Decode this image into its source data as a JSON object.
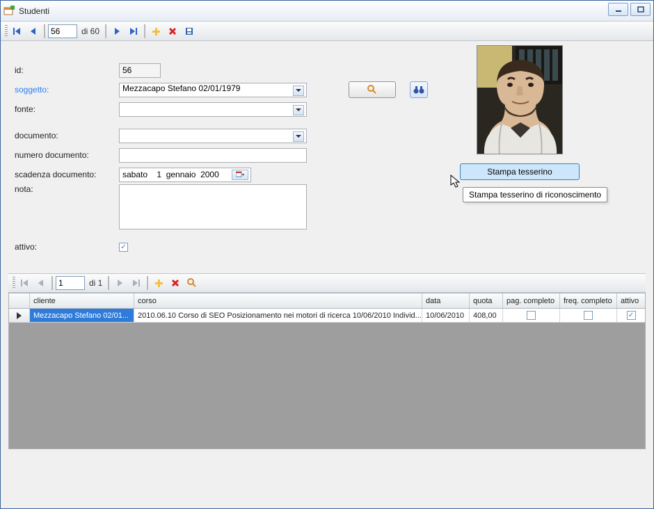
{
  "window": {
    "title": "Studenti"
  },
  "nav": {
    "value": "56",
    "total": "di 60"
  },
  "form": {
    "id_label": "id:",
    "id_value": "56",
    "soggetto_label": "soggetto:",
    "soggetto_value": "Mezzacapo Stefano 02/01/1979",
    "fonte_label": "fonte:",
    "fonte_value": "",
    "documento_label": "documento:",
    "documento_value": "",
    "numdoc_label": "numero documento:",
    "numdoc_value": "",
    "scadenza_label": "scadenza documento:",
    "scadenza_value": "sabato    1  gennaio  2000",
    "nota_label": "nota:",
    "nota_value": "",
    "attivo_label": "attivo:"
  },
  "stampa": {
    "label": "Stampa tesserino",
    "tooltip": "Stampa tesserino di riconoscimento"
  },
  "subnav": {
    "value": "1",
    "total": "di 1"
  },
  "grid": {
    "headers": {
      "cliente": "cliente",
      "corso": "corso",
      "data": "data",
      "quota": "quota",
      "pag": "pag. completo",
      "freq": "freq. completo",
      "attivo": "attivo"
    },
    "row": {
      "cliente": "Mezzacapo Stefano 02/01...",
      "corso": "2010.06.10 Corso di SEO Posizionamento nei motori di ricerca 10/06/2010 Individ...",
      "data": "10/06/2010",
      "quota": "408,00"
    }
  }
}
